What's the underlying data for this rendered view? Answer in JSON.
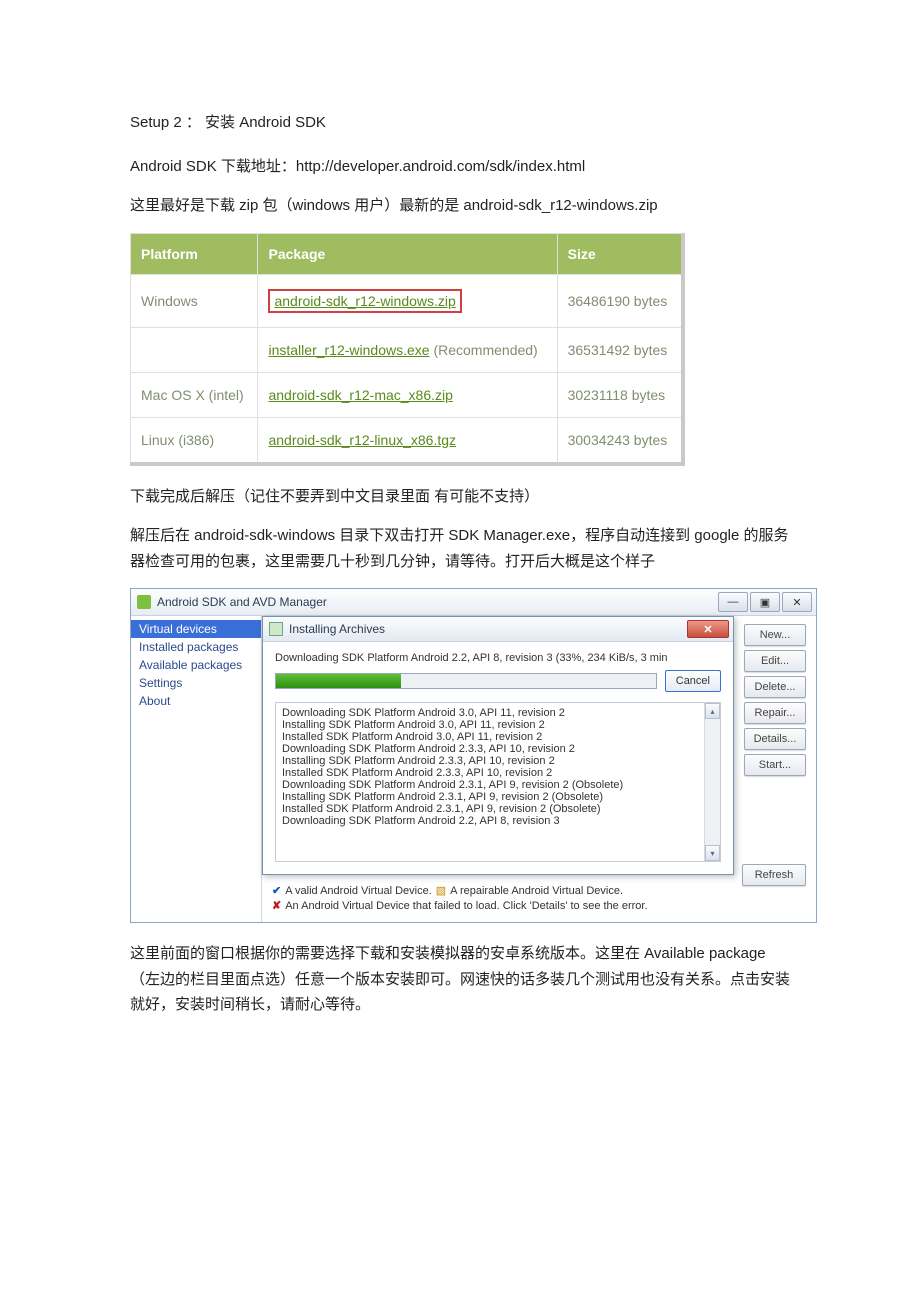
{
  "heading": "Setup 2 ： 安装 Android SDK",
  "p1": "Android SDK 下载地址：http://developer.android.com/sdk/index.html",
  "p2": "这里最好是下载 zip 包（windows 用户）最新的是 android-sdk_r12-windows.zip",
  "table": {
    "headers": {
      "platform": "Platform",
      "package": "Package",
      "size": "Size"
    },
    "rows": [
      {
        "platform": "Windows",
        "package": "android-sdk_r12-windows.zip",
        "recommended": "",
        "size": "36486190 bytes",
        "highlight": true
      },
      {
        "platform": "",
        "package": "installer_r12-windows.exe",
        "recommended": " (Recommended)",
        "size": "36531492 bytes"
      },
      {
        "platform": "Mac OS X (intel)",
        "package": "android-sdk_r12-mac_x86.zip",
        "recommended": "",
        "size": "30231118 bytes"
      },
      {
        "platform": "Linux (i386)",
        "package": "android-sdk_r12-linux_x86.tgz",
        "recommended": "",
        "size": "30034243 bytes"
      }
    ]
  },
  "p3": "下载完成后解压（记住不要弄到中文目录里面  有可能不支持）",
  "p4": "解压后在 android-sdk-windows 目录下双击打开 SDK Manager.exe，程序自动连接到 google 的服务器检查可用的包裹，这里需要几十秒到几分钟，请等待。打开后大概是这个样子",
  "win": {
    "title": "Android SDK and AVD Manager",
    "sidebar": [
      "Virtual devices",
      "Installed packages",
      "Available packages",
      "Settings",
      "About"
    ],
    "buttons": {
      "new": "New...",
      "edit": "Edit...",
      "delete": "Delete...",
      "repair": "Repair...",
      "details": "Details...",
      "start": "Start...",
      "refresh": "Refresh"
    },
    "legend": {
      "valid": "A valid Android Virtual Device.",
      "repairable": "A repairable Android Virtual Device.",
      "failed": "An Android Virtual Device that failed to load. Click 'Details' to see the error."
    }
  },
  "dlg": {
    "title": "Installing Archives",
    "status": "Downloading SDK Platform Android 2.2, API 8, revision 3 (33%, 234 KiB/s, 3 min",
    "cancel": "Cancel",
    "log": [
      "Downloading SDK Platform Android 3.0, API 11, revision 2",
      "Installing SDK Platform Android 3.0, API 11, revision 2",
      "Installed SDK Platform Android 3.0, API 11, revision 2",
      "Downloading SDK Platform Android 2.3.3, API 10, revision 2",
      "Installing SDK Platform Android 2.3.3, API 10, revision 2",
      "Installed SDK Platform Android 2.3.3, API 10, revision 2",
      "Downloading SDK Platform Android 2.3.1, API 9, revision 2 (Obsolete)",
      "Installing SDK Platform Android 2.3.1, API 9, revision 2 (Obsolete)",
      "Installed SDK Platform Android 2.3.1, API 9, revision 2 (Obsolete)",
      "Downloading SDK Platform Android 2.2, API 8, revision 3"
    ]
  },
  "p5": "这里前面的窗口根据你的需要选择下载和安装模拟器的安卓系统版本。这里在 Available package（左边的栏目里面点选）任意一个版本安装即可。网速快的话多装几个测试用也没有关系。点击安装就好，安装时间稍长，请耐心等待。"
}
